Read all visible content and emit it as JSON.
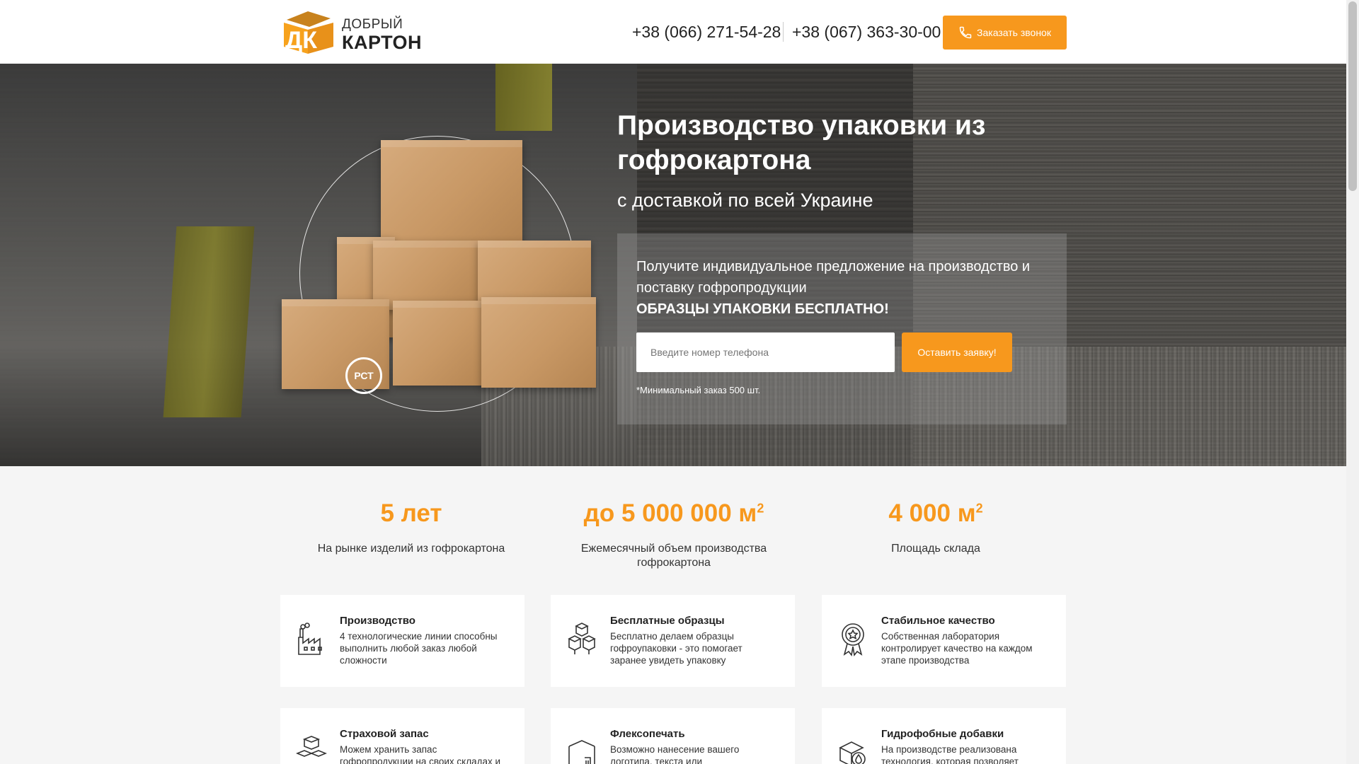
{
  "header": {
    "logo_line1": "ДОБРЫЙ",
    "logo_line2": "КАРТОН",
    "logo_mark": "ДК",
    "phone1": "+38 (066) 271-54-28",
    "phone2": "+38 (067) 363-30-00",
    "call_button": "Заказать звонок"
  },
  "hero": {
    "title": "Производство упаковки из гофрокартона",
    "subtitle": "с доставкой по всей Украине",
    "cert_mark": "РСТ",
    "form": {
      "text": "Получите индивидуальное предложение на производство и поставку гофропродукции",
      "bold_text": "ОБРАЗЦЫ УПАКОВКИ БЕСПЛАТНО!",
      "phone_placeholder": "Введите номер телефона",
      "submit_label": "Оставить заявку!",
      "note": "*Минимальный заказ 500 шт."
    }
  },
  "stats": [
    {
      "value": "5 лет",
      "sup": "",
      "label": "На рынке изделий из гофрокартона"
    },
    {
      "value": "до 5 000 000 м",
      "sup": "2",
      "label": "Ежемесячный объем производства гофрокартона"
    },
    {
      "value": "4 000 м",
      "sup": "2",
      "label": "Площадь склада"
    }
  ],
  "features": [
    {
      "icon": "factory-icon",
      "title": "Производство",
      "text": "4 технологические линии способны выполнить любой заказ любой сложности"
    },
    {
      "icon": "boxes-icon",
      "title": "Бесплатные образцы",
      "text": "Бесплатно делаем образцы гофроупаковки - это помогает заранее увидеть упаковку"
    },
    {
      "icon": "quality-badge-icon",
      "title": "Стабильное качество",
      "text": "Собственная лаборатория контролирует качество на каждом этапе производства"
    },
    {
      "icon": "stacked-boxes-icon",
      "title": "Страховой запас",
      "text": "Можем хранить запас гофропродукции на своих складах и"
    },
    {
      "icon": "print-box-icon",
      "title": "Флексопечать",
      "text": "Возможно нанесение вашего логотипа, текста или"
    },
    {
      "icon": "water-box-icon",
      "title": "Гидрофобные добавки",
      "text": "На производстве реализована технология, которая позволяет"
    }
  ],
  "colors": {
    "accent": "#f7981d",
    "box": "#c89865"
  }
}
